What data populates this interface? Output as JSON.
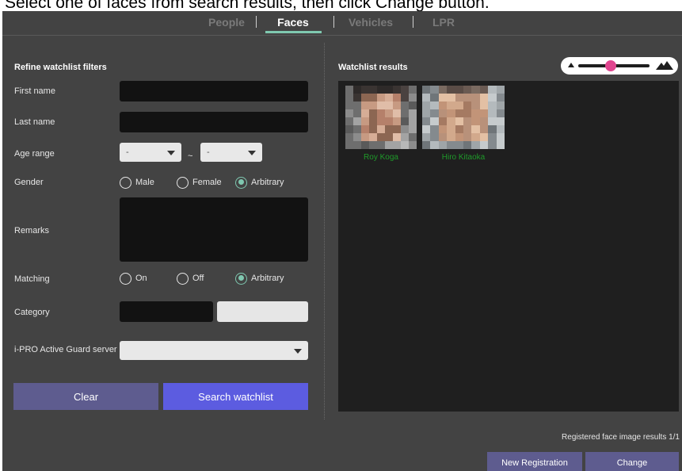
{
  "instruction": "Select one of faces from search results, then click Change button.",
  "tabs": [
    {
      "label": "People"
    },
    {
      "label": "Faces"
    },
    {
      "label": "Vehicles"
    },
    {
      "label": "LPR"
    }
  ],
  "filters": {
    "heading": "Refine watchlist filters",
    "first_name_label": "First name",
    "last_name_label": "Last name",
    "age_range_label": "Age range",
    "age_from": "-",
    "age_separator": "~",
    "age_to": "-",
    "gender_label": "Gender",
    "gender_options": [
      "Male",
      "Female",
      "Arbitrary"
    ],
    "gender_selected": "Arbitrary",
    "remarks_label": "Remarks",
    "matching_label": "Matching",
    "matching_options": [
      "On",
      "Off",
      "Arbitrary"
    ],
    "matching_selected": "Arbitrary",
    "category_label": "Category",
    "server_label": "i-PRO Active Guard server",
    "clear_label": "Clear",
    "search_label": "Search watchlist"
  },
  "results": {
    "heading": "Watchlist results",
    "faces": [
      {
        "name": "Roy Koga"
      },
      {
        "name": "Hiro Kitaoka"
      }
    ],
    "status_text": "Registered face image results 1/1",
    "new_registration_label": "New Registration",
    "change_label": "Change",
    "thumbnail_size_slider": 0.5
  },
  "colors": {
    "background": "#434343",
    "accent_tab": "#7fc8b0",
    "search_button": "#5c5ce0",
    "secondary_button": "#5e5c8f",
    "face_name": "#1f9a2a",
    "slider_thumb": "#e0458f"
  }
}
